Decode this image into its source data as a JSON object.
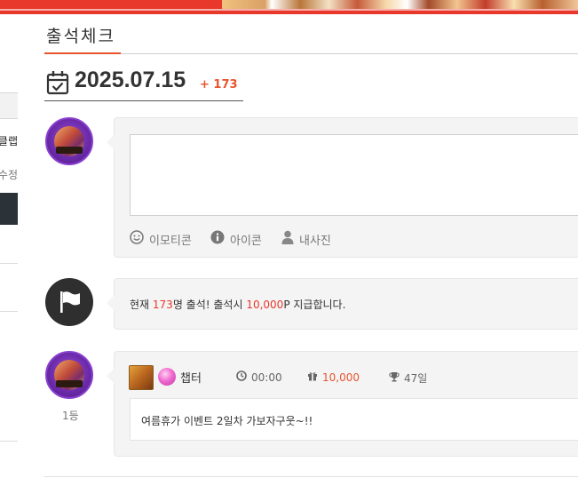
{
  "page": {
    "title": "출석체크",
    "date": "2025.07.15",
    "count_label": "+ 173"
  },
  "sidebar": {
    "fragment_a": "클랩",
    "fragment_b": "수정"
  },
  "compose": {
    "tools": [
      {
        "label": "이모티콘",
        "icon": "smile-icon"
      },
      {
        "label": "아이콘",
        "icon": "info-icon"
      },
      {
        "label": "내사진",
        "icon": "user-icon"
      }
    ]
  },
  "notice": {
    "prefix": "현재 ",
    "count": "173",
    "middle": "명 출석! 출석시 ",
    "points": "10,000",
    "suffix": "P 지급합니다."
  },
  "entry": {
    "rank": "1등",
    "name": "챕터",
    "time": "00:00",
    "points": "10,000",
    "streak": "47일",
    "comment": "여름휴가 이벤트 2일차 가보자구웃~!!"
  },
  "colors": {
    "accent": "#e8542f",
    "highlight": "#e8382b",
    "banner": "#e8382b"
  }
}
